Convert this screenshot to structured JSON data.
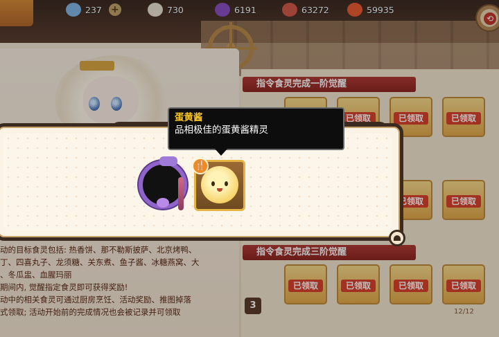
{
  "topbar": {
    "resources": [
      {
        "icon": "crystal-icon",
        "value": "237",
        "color": "#7fb6e6"
      },
      {
        "icon": "potion-icon",
        "value": "730",
        "color": "#e8e0d0"
      },
      {
        "icon": "amethyst-icon",
        "value": "6191",
        "color": "#8a4fc2"
      },
      {
        "icon": "meat-icon",
        "value": "63272",
        "color": "#d0584a"
      },
      {
        "icon": "fruit-icon",
        "value": "59935",
        "color": "#e85a32"
      }
    ],
    "add_symbol": "+"
  },
  "tasks": {
    "section1_title": "指令食灵完成一阶觉醒",
    "section3_title": "指令食灵完成三阶觉醒",
    "claimed_label": "已领取",
    "row3_number": "3",
    "page_count": "12/12"
  },
  "description": {
    "lines": [
      "动的目标食灵包括: 热香饼、那不勒斯披萨、北京烤鸭、",
      "丁、四喜丸子、龙须糖、关东煮、鱼子酱、冰糖燕窝、大",
      "、冬瓜盅、血腥玛丽",
      "期间内, 觉醒指定食灵即可获得奖励!",
      "动中的相关食灵可通过厨房烹饪、活动奖励、推图掉落",
      "式领取; 活动开始前的完成情况也会被记录并可领取"
    ]
  },
  "tooltip": {
    "title": "蛋黄酱",
    "description": "品相极佳的蛋黄酱精灵"
  },
  "reward": {
    "food_badge_symbol": "🍴"
  },
  "colors": {
    "accent_gold": "#f7c32a",
    "section_red": "#b03a34",
    "frame_purple": "#8f63c9"
  }
}
